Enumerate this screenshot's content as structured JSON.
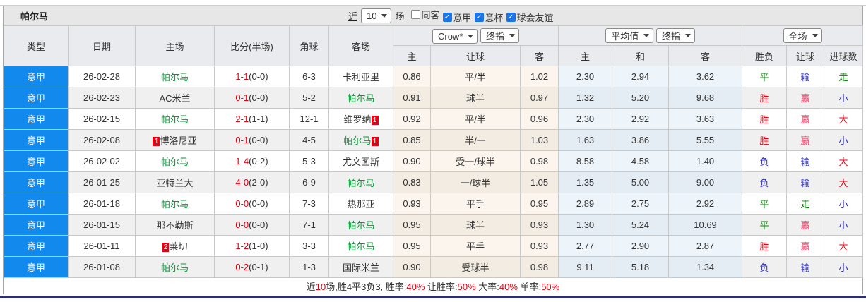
{
  "colors": {
    "league_blue": "#1289ec",
    "team_green": "#009933",
    "score_red": "#e60012",
    "result_red": "#e60012",
    "result_pink": "#f5365f",
    "result_green": "#008000",
    "result_blue": "#2e2ecc",
    "navy_bar": "#2e2e6e",
    "checkbox_blue": "#1a73e8"
  },
  "toolbar": {
    "team": "帕尔马",
    "recent_label": "近",
    "recent_value": "10",
    "matches_label": "场",
    "checkboxes": [
      {
        "label": "同客",
        "checked": false
      },
      {
        "label": "意甲",
        "checked": true
      },
      {
        "label": "意杯",
        "checked": true
      },
      {
        "label": "球会友谊",
        "checked": true
      }
    ]
  },
  "header": {
    "cols": [
      "类型",
      "日期",
      "主场",
      "比分(半场)",
      "角球",
      "客场"
    ],
    "group1": {
      "dropdown1": "Crow*",
      "dropdown2": "终指",
      "cols": [
        "主",
        "让球",
        "客"
      ]
    },
    "group2": {
      "dropdown1": "平均值",
      "dropdown2": "终指",
      "cols": [
        "主",
        "和",
        "客"
      ]
    },
    "group3": {
      "dropdown": "全场",
      "cols": [
        "胜负",
        "让球",
        "进球数"
      ]
    }
  },
  "rows": [
    {
      "league": "意甲",
      "date": "26-02-28",
      "home": {
        "name": "帕尔马",
        "green": true,
        "badge_before": "",
        "badge_after": ""
      },
      "score": "1-1",
      "half": "(0-0)",
      "corner": "6-3",
      "away": {
        "name": "卡利亚里",
        "green": false,
        "badge_before": "",
        "badge_after": ""
      },
      "odds1": [
        "0.86",
        "平/半",
        "1.02"
      ],
      "odds2": [
        "2.30",
        "2.94",
        "3.62"
      ],
      "result": {
        "text": "平",
        "color": "green"
      },
      "handicap": {
        "text": "输",
        "color": "blue"
      },
      "goals": {
        "text": "走",
        "color": "green"
      }
    },
    {
      "league": "意甲",
      "date": "26-02-23",
      "home": {
        "name": "AC米兰",
        "green": false,
        "badge_before": "",
        "badge_after": ""
      },
      "score": "0-1",
      "half": "(0-0)",
      "corner": "5-2",
      "away": {
        "name": "帕尔马",
        "green": true,
        "badge_before": "",
        "badge_after": ""
      },
      "odds1": [
        "0.91",
        "球半",
        "0.97"
      ],
      "odds2": [
        "1.32",
        "5.20",
        "9.68"
      ],
      "result": {
        "text": "胜",
        "color": "red"
      },
      "handicap": {
        "text": "赢",
        "color": "pink"
      },
      "goals": {
        "text": "小",
        "color": "blue"
      }
    },
    {
      "league": "意甲",
      "date": "26-02-15",
      "home": {
        "name": "帕尔马",
        "green": true,
        "badge_before": "",
        "badge_after": ""
      },
      "score": "2-1",
      "half": "(1-1)",
      "corner": "12-1",
      "away": {
        "name": "维罗纳",
        "green": false,
        "badge_before": "",
        "badge_after": "1"
      },
      "odds1": [
        "0.92",
        "平/半",
        "0.96"
      ],
      "odds2": [
        "2.30",
        "2.92",
        "3.63"
      ],
      "result": {
        "text": "胜",
        "color": "red"
      },
      "handicap": {
        "text": "赢",
        "color": "pink"
      },
      "goals": {
        "text": "大",
        "color": "red"
      }
    },
    {
      "league": "意甲",
      "date": "26-02-08",
      "home": {
        "name": "博洛尼亚",
        "green": false,
        "badge_before": "1",
        "badge_after": ""
      },
      "score": "0-1",
      "half": "(0-0)",
      "corner": "4-5",
      "away": {
        "name": "帕尔马",
        "green": true,
        "badge_before": "",
        "badge_after": "1"
      },
      "odds1": [
        "0.85",
        "半/一",
        "1.03"
      ],
      "odds2": [
        "1.63",
        "3.86",
        "5.55"
      ],
      "result": {
        "text": "胜",
        "color": "red"
      },
      "handicap": {
        "text": "赢",
        "color": "pink"
      },
      "goals": {
        "text": "小",
        "color": "blue"
      }
    },
    {
      "league": "意甲",
      "date": "26-02-02",
      "home": {
        "name": "帕尔马",
        "green": true,
        "badge_before": "",
        "badge_after": ""
      },
      "score": "1-4",
      "half": "(0-2)",
      "corner": "5-3",
      "away": {
        "name": "尤文图斯",
        "green": false,
        "badge_before": "",
        "badge_after": ""
      },
      "odds1": [
        "0.90",
        "受一/球半",
        "0.98"
      ],
      "odds2": [
        "8.58",
        "4.58",
        "1.40"
      ],
      "result": {
        "text": "负",
        "color": "blue"
      },
      "handicap": {
        "text": "输",
        "color": "blue"
      },
      "goals": {
        "text": "大",
        "color": "red"
      }
    },
    {
      "league": "意甲",
      "date": "26-01-25",
      "home": {
        "name": "亚特兰大",
        "green": false,
        "badge_before": "",
        "badge_after": ""
      },
      "score": "4-0",
      "half": "(2-0)",
      "corner": "6-9",
      "away": {
        "name": "帕尔马",
        "green": true,
        "badge_before": "",
        "badge_after": ""
      },
      "odds1": [
        "0.83",
        "一/球半",
        "1.05"
      ],
      "odds2": [
        "1.35",
        "5.00",
        "9.00"
      ],
      "result": {
        "text": "负",
        "color": "blue"
      },
      "handicap": {
        "text": "输",
        "color": "blue"
      },
      "goals": {
        "text": "大",
        "color": "red"
      }
    },
    {
      "league": "意甲",
      "date": "26-01-18",
      "home": {
        "name": "帕尔马",
        "green": true,
        "badge_before": "",
        "badge_after": ""
      },
      "score": "0-0",
      "half": "(0-0)",
      "corner": "7-3",
      "away": {
        "name": "热那亚",
        "green": false,
        "badge_before": "",
        "badge_after": ""
      },
      "odds1": [
        "0.93",
        "平手",
        "0.95"
      ],
      "odds2": [
        "2.89",
        "2.75",
        "2.92"
      ],
      "result": {
        "text": "平",
        "color": "green"
      },
      "handicap": {
        "text": "走",
        "color": "green"
      },
      "goals": {
        "text": "小",
        "color": "blue"
      }
    },
    {
      "league": "意甲",
      "date": "26-01-15",
      "home": {
        "name": "那不勒斯",
        "green": false,
        "badge_before": "",
        "badge_after": ""
      },
      "score": "0-0",
      "half": "(0-0)",
      "corner": "7-1",
      "away": {
        "name": "帕尔马",
        "green": true,
        "badge_before": "",
        "badge_after": ""
      },
      "odds1": [
        "0.95",
        "球半",
        "0.93"
      ],
      "odds2": [
        "1.30",
        "5.24",
        "10.69"
      ],
      "result": {
        "text": "平",
        "color": "green"
      },
      "handicap": {
        "text": "赢",
        "color": "pink"
      },
      "goals": {
        "text": "小",
        "color": "blue"
      }
    },
    {
      "league": "意甲",
      "date": "26-01-11",
      "home": {
        "name": "莱切",
        "green": false,
        "badge_before": "2",
        "badge_after": ""
      },
      "score": "1-2",
      "half": "(1-0)",
      "corner": "3-3",
      "away": {
        "name": "帕尔马",
        "green": true,
        "badge_before": "",
        "badge_after": ""
      },
      "odds1": [
        "0.95",
        "平手",
        "0.93"
      ],
      "odds2": [
        "2.77",
        "2.90",
        "2.87"
      ],
      "result": {
        "text": "胜",
        "color": "red"
      },
      "handicap": {
        "text": "赢",
        "color": "pink"
      },
      "goals": {
        "text": "大",
        "color": "red"
      }
    },
    {
      "league": "意甲",
      "date": "26-01-08",
      "home": {
        "name": "帕尔马",
        "green": true,
        "badge_before": "",
        "badge_after": ""
      },
      "score": "0-2",
      "half": "(0-1)",
      "corner": "1-3",
      "away": {
        "name": "国际米兰",
        "green": false,
        "badge_before": "",
        "badge_after": ""
      },
      "odds1": [
        "0.90",
        "受球半",
        "0.98"
      ],
      "odds2": [
        "9.11",
        "5.18",
        "1.34"
      ],
      "result": {
        "text": "负",
        "color": "blue"
      },
      "handicap": {
        "text": "输",
        "color": "blue"
      },
      "goals": {
        "text": "小",
        "color": "blue"
      }
    }
  ],
  "footer": {
    "segments": [
      {
        "text": "近",
        "color": "dark"
      },
      {
        "text": "10",
        "color": "red"
      },
      {
        "text": "场,胜4平3负3, 胜率:",
        "color": "dark"
      },
      {
        "text": "40%",
        "color": "red"
      },
      {
        "text": " 让胜率:",
        "color": "dark"
      },
      {
        "text": "50%",
        "color": "red"
      },
      {
        "text": " 大率:",
        "color": "dark"
      },
      {
        "text": "40%",
        "color": "red"
      },
      {
        "text": " 单率:",
        "color": "dark"
      },
      {
        "text": "50%",
        "color": "red"
      }
    ]
  }
}
